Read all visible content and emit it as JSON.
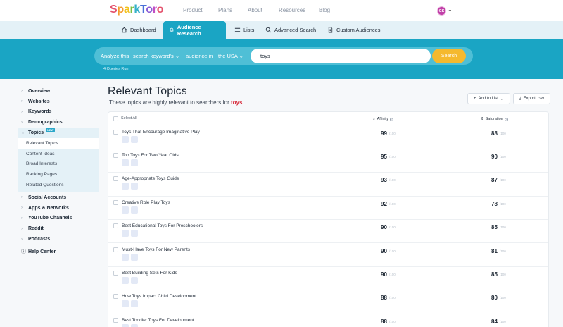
{
  "brand": {
    "logo_letters": [
      "S",
      "p",
      "a",
      "r",
      "k",
      "T",
      "o",
      "r",
      "o"
    ]
  },
  "topnav": {
    "links": [
      "Product",
      "Plans",
      "About",
      "Resources",
      "Blog"
    ],
    "avatar_initials": "CS"
  },
  "subnav": {
    "tabs": [
      "Dashboard",
      "Audience Research",
      "Lists",
      "Advanced Search",
      "Custom Audiences"
    ],
    "active_tab": "Audience Research"
  },
  "search": {
    "analyze_label": "Analyze this",
    "analyze_value": "search keyword's",
    "audience_label": "audience in",
    "audience_value": "the USA",
    "query": "toys",
    "button": "Search",
    "queries_run": "4 Queries Run"
  },
  "sidebar": {
    "items_top": [
      "Overview",
      "Websites",
      "Keywords",
      "Demographics"
    ],
    "topics": {
      "label": "Topics",
      "badge": "NEW",
      "sub": [
        "Relevant Topics",
        "Content Ideas",
        "Broad Interests",
        "Ranking Pages",
        "Related Questions"
      ],
      "active_sub": "Relevant Topics"
    },
    "items_bottom": [
      "Social Accounts",
      "Apps & Networks",
      "YouTube Channels",
      "Reddit",
      "Podcasts"
    ],
    "help": "Help Center"
  },
  "main": {
    "title": "Relevant Topics",
    "subtitle_prefix": "These topics are highly relevant to searchers for",
    "subtitle_keyword": "toys",
    "subtitle_suffix": ".",
    "add_to_list": "Add to List",
    "export": "Export .csv"
  },
  "table": {
    "select_all": "Select All",
    "col_affinity": "Affinity",
    "col_saturation": "Saturation",
    "unit": "/100",
    "rows": [
      {
        "title": "Toys That Encourage Imaginative Play",
        "affinity": "99",
        "saturation": "88"
      },
      {
        "title": "Top Toys For Two Year Olds",
        "affinity": "95",
        "saturation": "90"
      },
      {
        "title": "Age-Appropriate Toys Guide",
        "affinity": "93",
        "saturation": "87"
      },
      {
        "title": "Creative Role Play Toys",
        "affinity": "92",
        "saturation": "78"
      },
      {
        "title": "Best Educational Toys For Preschoolers",
        "affinity": "90",
        "saturation": "85"
      },
      {
        "title": "Must-Have Toys For New Parents",
        "affinity": "90",
        "saturation": "81"
      },
      {
        "title": "Best Building Sets For Kids",
        "affinity": "90",
        "saturation": "85"
      },
      {
        "title": "How Toys Impact Child Development",
        "affinity": "88",
        "saturation": "80"
      },
      {
        "title": "Best Toddler Toys For Development",
        "affinity": "88",
        "saturation": "84"
      }
    ]
  },
  "colors": {
    "accent": "#1aa5c4",
    "search_button": "#f5b92e",
    "keyword": "#d8303f",
    "avatar": "#c13fa8"
  }
}
